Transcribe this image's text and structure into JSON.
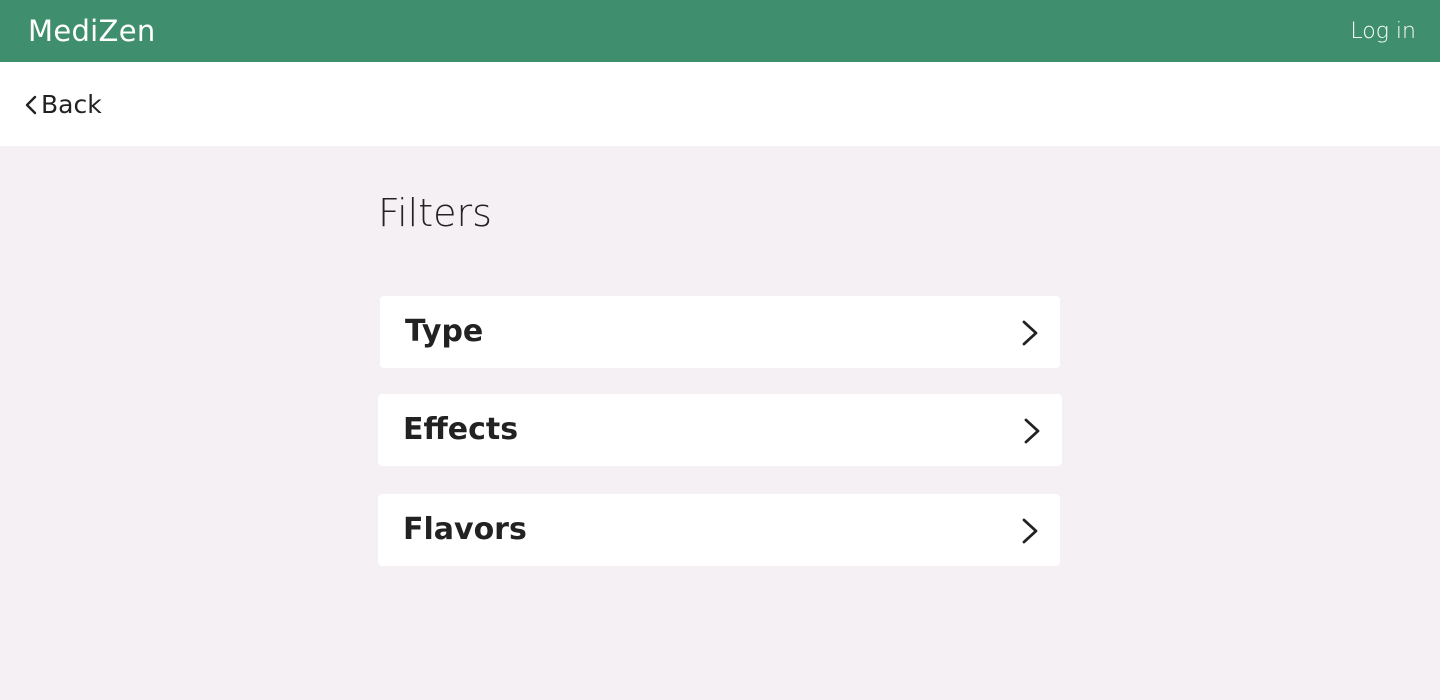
{
  "header": {
    "brand": "MediZen",
    "login_label": "Log in",
    "background_color": "#3f8f6f"
  },
  "nav": {
    "back_label": "Back",
    "back_icon": "chevron-left-icon"
  },
  "main": {
    "title": "Filters",
    "filters": [
      {
        "label": "Type",
        "icon": "chevron-right-icon"
      },
      {
        "label": "Effects",
        "icon": "chevron-right-icon"
      },
      {
        "label": "Flavors",
        "icon": "chevron-right-icon"
      }
    ]
  }
}
